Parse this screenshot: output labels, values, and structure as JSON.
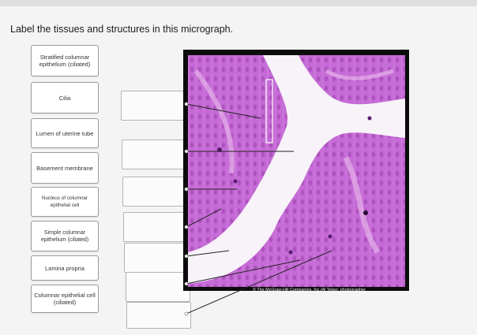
{
  "question": {
    "prompt": "Label the tissues and structures in this micrograph."
  },
  "label_bank": [
    {
      "text": "Stratified columnar epithelium (ciliated)"
    },
    {
      "text": "Cilia"
    },
    {
      "text": "Lumen of uterine tube"
    },
    {
      "text": "Basement membrane"
    },
    {
      "text": "Nucleus of columnar epithelial cell"
    },
    {
      "text": "Simple columnar epithelium (ciliated)"
    },
    {
      "text": "Lamina propria"
    },
    {
      "text": "Columnar epithelial cell (ciliated)"
    }
  ],
  "drop_targets": {
    "count": 8,
    "filled": []
  },
  "micrograph": {
    "credit": "© The McGraw-Hill Companies, Inc./Al Telser, photographer",
    "colors": {
      "tissue": "#c56ad6",
      "tissue_light": "#e6b3ea",
      "tissue_dark": "#8d2f9c",
      "lumen": "#f7f3f8",
      "nucleus": "#5a1a6e",
      "frame": "#0c0c0c"
    }
  }
}
